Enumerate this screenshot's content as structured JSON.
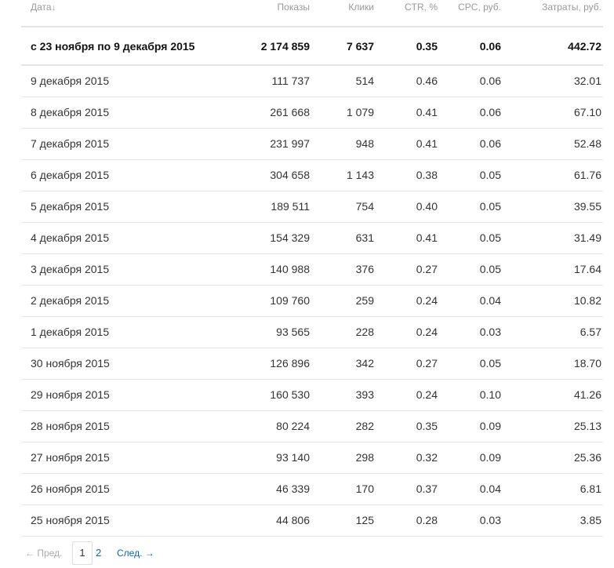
{
  "table": {
    "header": {
      "date": "Дата",
      "date_sort_icon": "↓",
      "impressions": "Показы",
      "clicks": "Клики",
      "ctr": "CTR, %",
      "cpc": "CPC, руб.",
      "cost": "Затраты, руб."
    },
    "total": {
      "date": "с 23 ноября по 9 декабря 2015",
      "impressions": "2 174 859",
      "clicks": "7 637",
      "ctr": "0.35",
      "cpc": "0.06",
      "cost": "442.72"
    },
    "rows": [
      {
        "date": "9 декабря 2015",
        "impressions": "111 737",
        "clicks": "514",
        "ctr": "0.46",
        "cpc": "0.06",
        "cost": "32.01"
      },
      {
        "date": "8 декабря 2015",
        "impressions": "261 668",
        "clicks": "1 079",
        "ctr": "0.41",
        "cpc": "0.06",
        "cost": "67.10"
      },
      {
        "date": "7 декабря 2015",
        "impressions": "231 997",
        "clicks": "948",
        "ctr": "0.41",
        "cpc": "0.06",
        "cost": "52.48"
      },
      {
        "date": "6 декабря 2015",
        "impressions": "304 658",
        "clicks": "1 143",
        "ctr": "0.38",
        "cpc": "0.05",
        "cost": "61.76"
      },
      {
        "date": "5 декабря 2015",
        "impressions": "189 511",
        "clicks": "754",
        "ctr": "0.40",
        "cpc": "0.05",
        "cost": "39.55"
      },
      {
        "date": "4 декабря 2015",
        "impressions": "154 329",
        "clicks": "631",
        "ctr": "0.41",
        "cpc": "0.05",
        "cost": "31.49"
      },
      {
        "date": "3 декабря 2015",
        "impressions": "140 988",
        "clicks": "376",
        "ctr": "0.27",
        "cpc": "0.05",
        "cost": "17.64"
      },
      {
        "date": "2 декабря 2015",
        "impressions": "109 760",
        "clicks": "259",
        "ctr": "0.24",
        "cpc": "0.04",
        "cost": "10.82"
      },
      {
        "date": "1 декабря 2015",
        "impressions": "93 565",
        "clicks": "228",
        "ctr": "0.24",
        "cpc": "0.03",
        "cost": "6.57"
      },
      {
        "date": "30 ноября 2015",
        "impressions": "126 896",
        "clicks": "342",
        "ctr": "0.27",
        "cpc": "0.05",
        "cost": "18.70"
      },
      {
        "date": "29 ноября 2015",
        "impressions": "160 530",
        "clicks": "393",
        "ctr": "0.24",
        "cpc": "0.10",
        "cost": "41.26"
      },
      {
        "date": "28 ноября 2015",
        "impressions": "80 224",
        "clicks": "282",
        "ctr": "0.35",
        "cpc": "0.09",
        "cost": "25.13"
      },
      {
        "date": "27 ноября 2015",
        "impressions": "93 140",
        "clicks": "298",
        "ctr": "0.32",
        "cpc": "0.09",
        "cost": "25.36"
      },
      {
        "date": "26 ноября 2015",
        "impressions": "46 339",
        "clicks": "170",
        "ctr": "0.37",
        "cpc": "0.04",
        "cost": "6.81"
      },
      {
        "date": "25 ноября 2015",
        "impressions": "44 806",
        "clicks": "125",
        "ctr": "0.28",
        "cpc": "0.03",
        "cost": "3.85"
      }
    ]
  },
  "pagination": {
    "prev_label": "← Пред.",
    "pages": [
      "1",
      "2"
    ],
    "current_page": "1",
    "next_label": "След. →"
  },
  "colors": {
    "link": "#0a64b4",
    "header_text": "#999999",
    "divider": "#e6e6e6"
  }
}
